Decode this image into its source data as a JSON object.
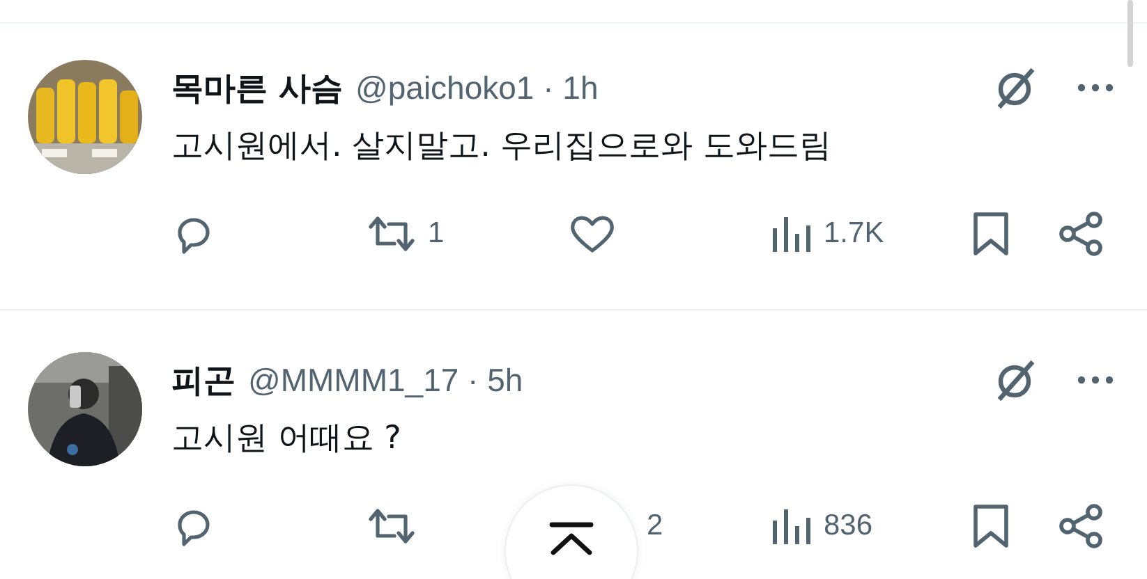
{
  "tweets": [
    {
      "name": "목마른 사슴",
      "meta": "@paichoko1 · 1h",
      "text": "고시원에서. 살지말고.  우리집으로와  도와드림",
      "actions": [
        {
          "kind": "reply"
        },
        {
          "kind": "repost",
          "count": "1"
        },
        {
          "kind": "like"
        },
        {
          "kind": "views",
          "count": "1.7K"
        },
        {
          "kind": "bookmark"
        },
        {
          "kind": "share"
        }
      ]
    },
    {
      "name": "피곤",
      "meta": "@MMMM1_17 · 5h",
      "text": "고시원 어때요 ?",
      "actions": [
        {
          "kind": "reply"
        },
        {
          "kind": "repost"
        },
        {
          "kind": "count_only",
          "count": "2"
        },
        {
          "kind": "views",
          "count": "836"
        },
        {
          "kind": "bookmark"
        },
        {
          "kind": "share"
        }
      ]
    }
  ]
}
